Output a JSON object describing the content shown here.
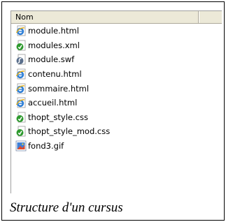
{
  "list": {
    "column_header": "Nom",
    "files": [
      {
        "name": "module.html",
        "icon": "ie-html-icon"
      },
      {
        "name": "modules.xml",
        "icon": "xml-file-icon"
      },
      {
        "name": "module.swf",
        "icon": "flash-swf-icon"
      },
      {
        "name": "contenu.html",
        "icon": "ie-html-icon"
      },
      {
        "name": "sommaire.html",
        "icon": "ie-html-icon"
      },
      {
        "name": "accueil.html",
        "icon": "ie-html-icon"
      },
      {
        "name": "thopt_style.css",
        "icon": "css-file-icon"
      },
      {
        "name": "thopt_style_mod.css",
        "icon": "css-file-icon"
      },
      {
        "name": "fond3.gif",
        "icon": "gif-image-icon"
      }
    ]
  },
  "caption": "Structure d'un cursus"
}
